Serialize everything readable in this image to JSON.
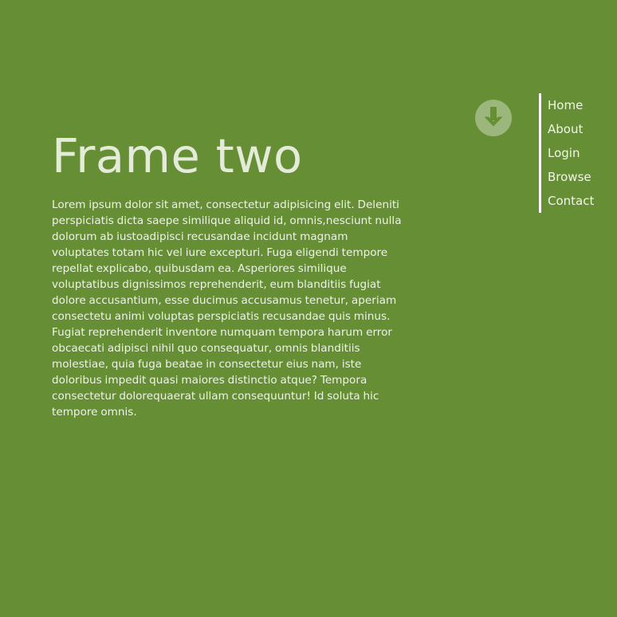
{
  "page": {
    "background_color": "#668f35",
    "title": "Frame two",
    "body_text": "Lorem ipsum dolor sit amet, consectetur adipisicing elit. Deleniti perspiciatis dicta saepe similique aliquid id, omnis,nesciunt nulla dolorum ab iustoadipisci recusandae incidunt magnam voluptates totam hic vel iure excepturi. Fuga eligendi tempore repellat explicabo, quibusdam ea. Asperiores similique voluptatibus dignissimos reprehenderit, eum blanditiis fugiat dolore accusantium, esse ducimus accusamus tenetur, aperiam consectetu animi voluptas perspiciatis recusandae quis minus. Fugiat reprehenderit inventore numquam tempora harum error obcaecati adipisci nihil quo consequatur, omnis blanditiis molestiae, quia fuga beatae in consectetur eius nam, iste doloribus impedit quasi maiores distinctio atque? Tempora consectetur dolorequaerat ullam consequuntur! Id soluta hic tempore omnis."
  },
  "scroll_button": {
    "icon": "arrow-down-circle-icon",
    "color": "#9bb77c"
  },
  "nav": {
    "border_color": "#ffffff",
    "items": [
      {
        "label": "Home"
      },
      {
        "label": "About"
      },
      {
        "label": "Login"
      },
      {
        "label": "Browse"
      },
      {
        "label": "Contact"
      }
    ]
  }
}
